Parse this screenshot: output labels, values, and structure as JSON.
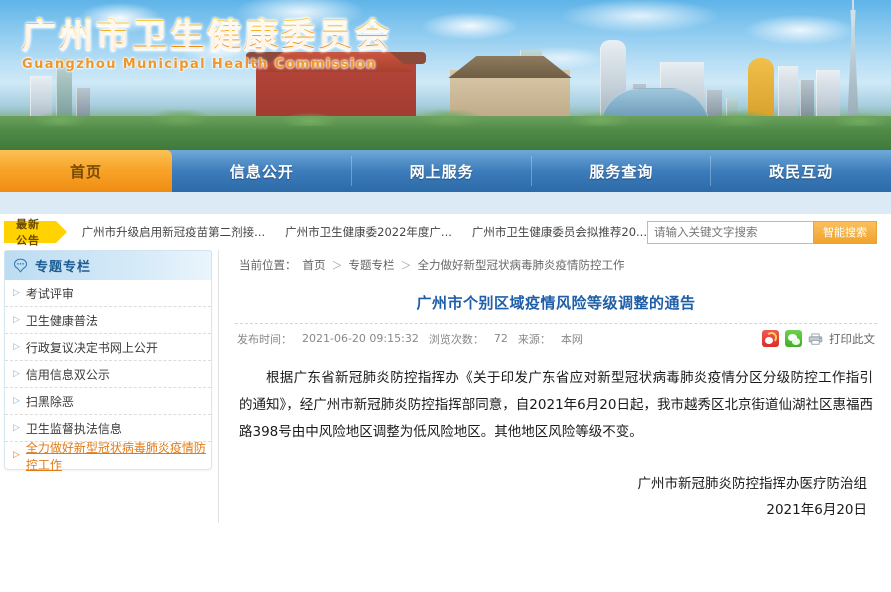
{
  "site": {
    "logo_cn": "广州市卫生健康委员会",
    "logo_en": "Guangzhou Municipal Health Commission"
  },
  "nav": {
    "items": [
      {
        "label": "首页",
        "active": true
      },
      {
        "label": "信息公开",
        "active": false
      },
      {
        "label": "网上服务",
        "active": false
      },
      {
        "label": "服务查询",
        "active": false
      },
      {
        "label": "政民互动",
        "active": false
      }
    ]
  },
  "announce": {
    "tag": "最新公告",
    "items": [
      "广州市升级启用新冠疫苗第二剂接...",
      "广州市卫生健康委2022年度广...",
      "广州市卫生健康委员会拟推荐20..."
    ]
  },
  "search": {
    "placeholder": "请输入关键文字搜索",
    "value": "",
    "button": "智能搜索"
  },
  "sidebar": {
    "title": "专题专栏",
    "items": [
      {
        "label": "考试评审",
        "active": false
      },
      {
        "label": "卫生健康普法",
        "active": false
      },
      {
        "label": "行政复议决定书网上公开",
        "active": false
      },
      {
        "label": "信用信息双公示",
        "active": false
      },
      {
        "label": "扫黑除恶",
        "active": false
      },
      {
        "label": "卫生监督执法信息",
        "active": false
      },
      {
        "label": "全力做好新型冠状病毒肺炎疫情防控工作",
        "active": true
      }
    ]
  },
  "breadcrumb": {
    "prefix": "当前位置：",
    "items": [
      "首页",
      "专题专栏",
      "全力做好新型冠状病毒肺炎疫情防控工作"
    ],
    "separator": "＞"
  },
  "article": {
    "title": "广州市个别区域疫情风险等级调整的通告",
    "meta": {
      "publish_label": "发布时间：",
      "publish_time": "2021-06-20 09:15:32",
      "views_label": "浏览次数：",
      "views": "72",
      "source_label": "来源：",
      "source": "本网"
    },
    "print_label": "打印此文",
    "paragraphs": [
      "根据广东省新冠肺炎防控指挥办《关于印发广东省应对新型冠状病毒肺炎疫情分区分级防控工作指引的通知》，经广州市新冠肺炎防控指挥部同意，自2021年6月20日起，我市越秀区北京街道仙湖社区惠福西路398号由中风险地区调整为低风险地区。其他地区风险等级不变。"
    ],
    "signature_org": "广州市新冠肺炎防控指挥办医疗防治组",
    "signature_date": "2021年6月20日"
  },
  "colors": {
    "brand_orange": "#f08c12",
    "nav_blue": "#2c6aa8",
    "title_blue": "#1f5fa8",
    "active_link": "#e07b16"
  }
}
